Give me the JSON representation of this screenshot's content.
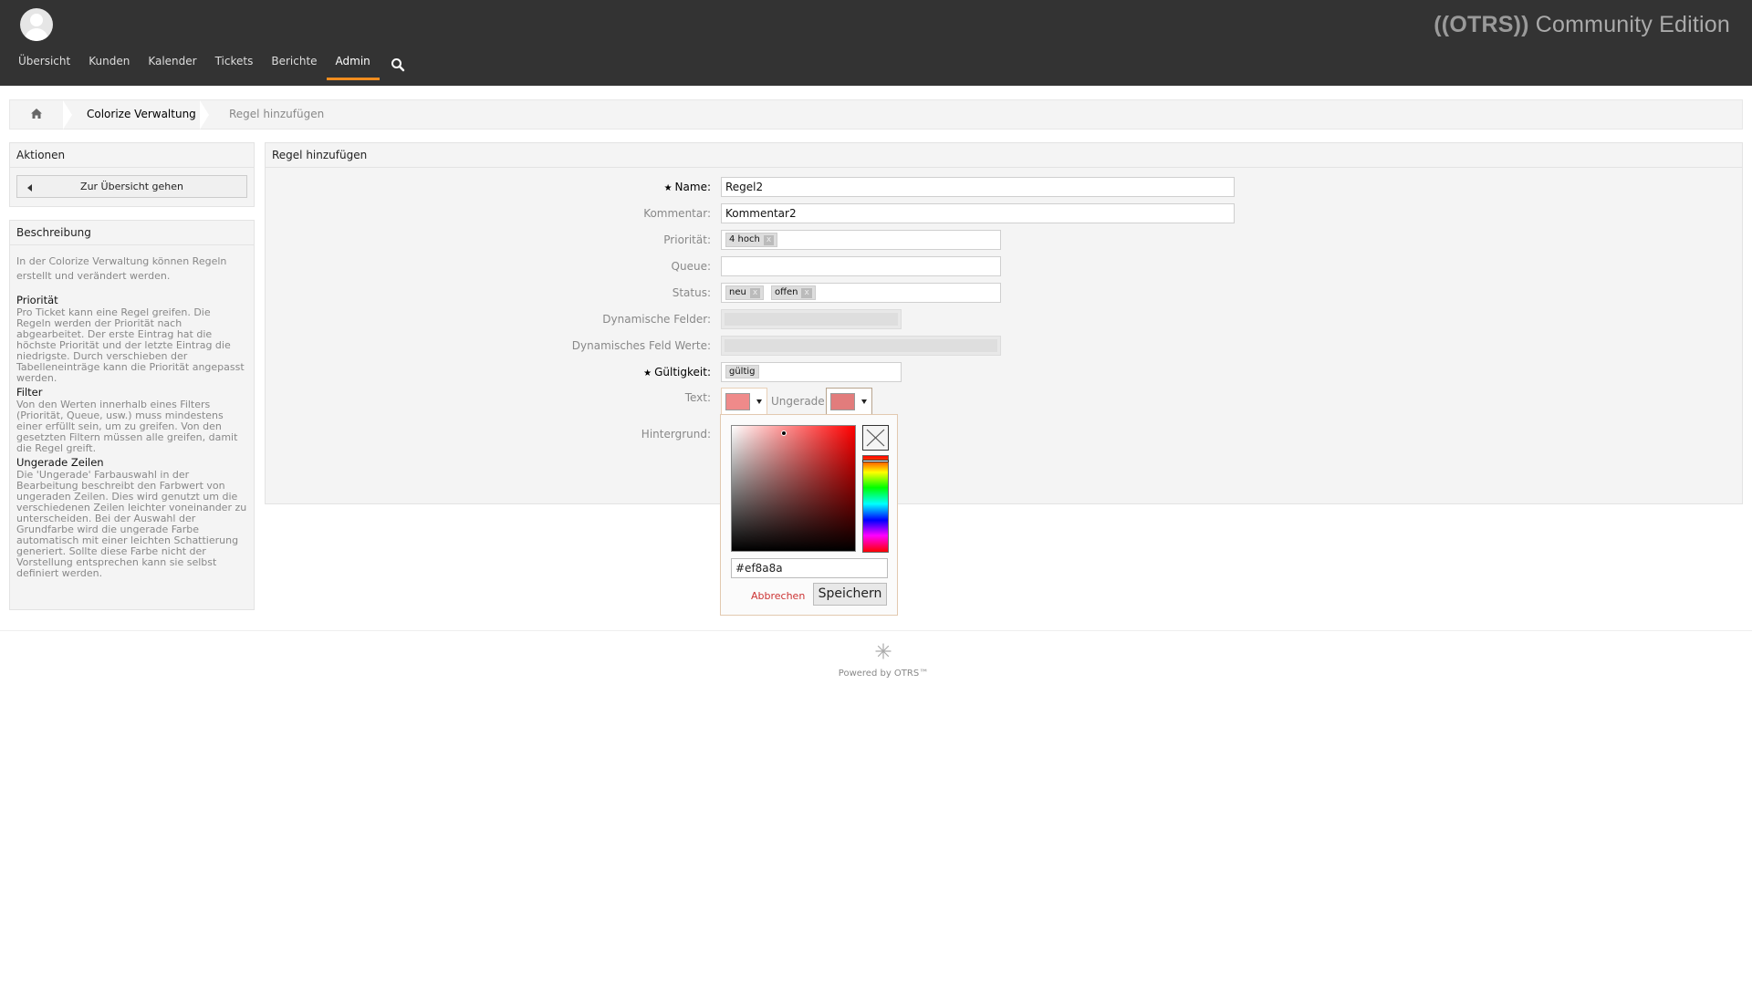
{
  "header": {
    "brand_prefix": "((OTRS))",
    "brand_suffix": "Community Edition",
    "nav": [
      {
        "label": "Übersicht"
      },
      {
        "label": "Kunden"
      },
      {
        "label": "Kalender"
      },
      {
        "label": "Tickets"
      },
      {
        "label": "Berichte"
      },
      {
        "label": "Admin"
      }
    ],
    "active_nav": "Admin",
    "accent_color": "#f08c1e"
  },
  "breadcrumb": {
    "items": [
      "Colorize Verwaltung",
      "Regel hinzufügen"
    ]
  },
  "sidebar": {
    "actions_title": "Aktionen",
    "back_button": "Zur Übersicht gehen",
    "description_title": "Beschreibung",
    "intro": "In der Colorize Verwaltung können Regeln erstellt und verändert werden.",
    "sections": [
      {
        "title": "Priorität",
        "text": "Pro Ticket kann eine Regel greifen. Die Regeln werden der Priorität nach abgearbeitet. Der erste Eintrag hat die höchste Priorität und der letzte Eintrag die niedrigste. Durch verschieben der Tabelleneinträge kann die Priorität angepasst werden."
      },
      {
        "title": "Filter",
        "text": "Von den Werten innerhalb eines Filters (Priorität, Queue, usw.) muss mindestens einer erfüllt sein, um zu greifen. Von den gesetzten Filtern müssen alle greifen, damit die Regel greift."
      },
      {
        "title": "Ungerade Zeilen",
        "text": "Die 'Ungerade' Farbauswahl in der Bearbeitung beschreibt den Farbwert von ungeraden Zeilen. Dies wird genutzt um die verschiedenen Zeilen leichter voneinander zu unterscheiden. Bei der Auswahl der Grundfarbe wird die ungerade Farbe automatisch mit einer leichten Schattierung generiert. Sollte diese Farbe nicht der Vorstellung entsprechen kann sie selbst definiert werden."
      }
    ]
  },
  "main": {
    "title": "Regel hinzufügen",
    "fields": {
      "name_label": "Name:",
      "name_value": "Regel2",
      "comment_label": "Kommentar:",
      "comment_value": "Kommentar2",
      "priority_label": "Priorität:",
      "priority_tags": [
        "4 hoch"
      ],
      "queue_label": "Queue:",
      "status_label": "Status:",
      "status_tags": [
        "neu",
        "offen"
      ],
      "dynamic_fields_label": "Dynamische Felder:",
      "dynamic_values_label": "Dynamisches Feld Werte:",
      "validity_label": "Gültigkeit:",
      "validity_tag": "gültig",
      "text_label": "Text:",
      "odd_label": "Ungerade:",
      "background_label": "Hintergrund:",
      "tag_remove": "x",
      "required_star": "★"
    },
    "colors": {
      "text_swatch": "#ef8a8a",
      "odd_swatch": "#e27c7c"
    }
  },
  "picker": {
    "hex_value": "#ef8a8a",
    "cancel_label": "Abbrechen",
    "save_label": "Speichern"
  },
  "footer": {
    "powered_by": "Powered by OTRS™"
  }
}
